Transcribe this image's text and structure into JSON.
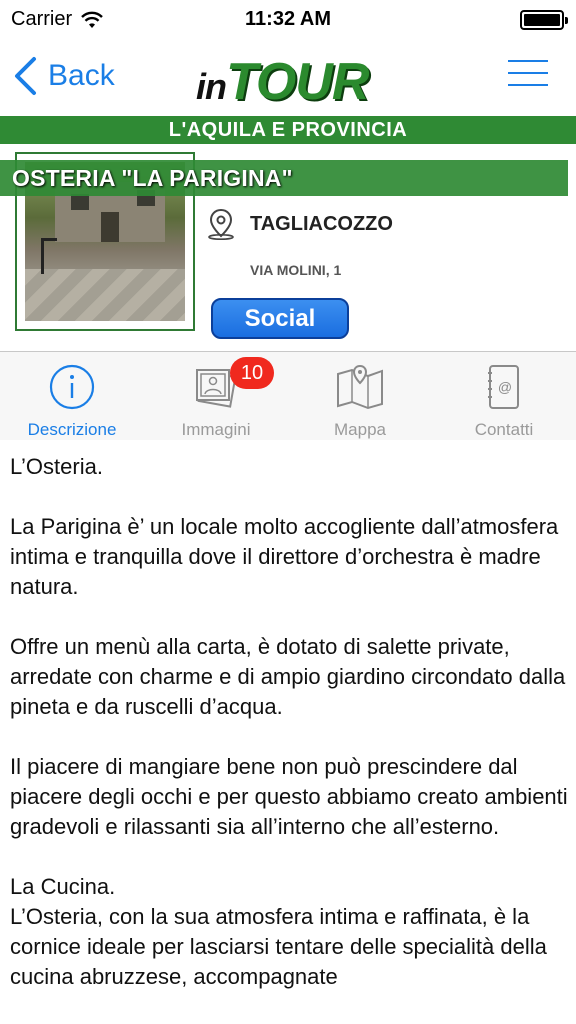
{
  "status": {
    "carrier": "Carrier",
    "time": "11:32 AM"
  },
  "nav": {
    "back_label": "Back",
    "logo_in": "in",
    "logo_tour": "TOUR"
  },
  "region": "L'AQUILA E PROVINCIA",
  "place": {
    "name": "OSTERIA \"LA PARIGINA\"",
    "city": "TAGLIACOZZO",
    "address": "VIA MOLINI, 1",
    "social_label": "Social"
  },
  "tabs": [
    {
      "label": "Descrizione",
      "icon": "info-icon",
      "active": true
    },
    {
      "label": "Immagini",
      "icon": "images-icon",
      "active": false,
      "badge": "10"
    },
    {
      "label": "Mappa",
      "icon": "map-icon",
      "active": false
    },
    {
      "label": "Contatti",
      "icon": "contacts-icon",
      "active": false
    }
  ],
  "colors": {
    "accent": "#1a7ee6",
    "green": "#2f8a34",
    "badge": "#f0291e"
  },
  "description": {
    "p1": "L’Osteria.",
    "p2": "La Parigina è’ un locale molto accogliente dall’atmosfera intima e tranquilla dove il direttore d’orchestra è madre natura.",
    "p3": "Offre un menù alla carta, è dotato di salette private, arredate con charme e di ampio giardino circondato dalla pineta e da ruscelli d’acqua.",
    "p4": "Il piacere di mangiare bene non può prescindere dal piacere degli occhi e per questo abbiamo creato ambienti gradevoli e rilassanti sia all’interno che all’esterno.",
    "p5": "La Cucina.",
    "p6": "L’Osteria, con la sua atmosfera intima e raffinata, è la cornice ideale per lasciarsi tentare delle specialità della cucina abruzzese, accompagnate"
  }
}
